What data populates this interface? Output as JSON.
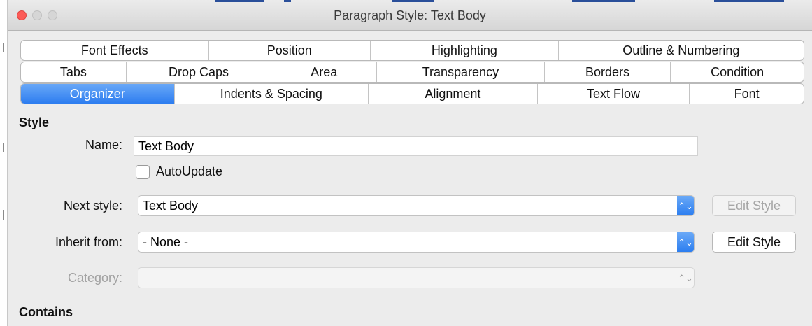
{
  "window": {
    "title": "Paragraph Style: Text Body",
    "accent_color": "#2d7df0",
    "close_color": "#fc5b57"
  },
  "tabs": {
    "row1": [
      "Font Effects",
      "Position",
      "Highlighting",
      "Outline & Numbering"
    ],
    "row2": [
      "Tabs",
      "Drop Caps",
      "Area",
      "Transparency",
      "Borders",
      "Condition"
    ],
    "row3": [
      "Organizer",
      "Indents & Spacing",
      "Alignment",
      "Text Flow",
      "Font"
    ],
    "active": "Organizer"
  },
  "style_section": {
    "heading": "Style",
    "name_label": "Name:",
    "name_value": "Text Body",
    "autoupdate_label": "AutoUpdate",
    "autoupdate_checked": false,
    "next_style_label": "Next style:",
    "next_style_value": "Text Body",
    "next_style_edit_label": "Edit Style",
    "inherit_label": "Inherit from:",
    "inherit_value": "- None -",
    "inherit_edit_label": "Edit Style",
    "category_label": "Category:",
    "category_value": ""
  },
  "contains_section": {
    "heading": "Contains"
  },
  "icons": {
    "select_arrow": "up-down-chevron-icon"
  }
}
